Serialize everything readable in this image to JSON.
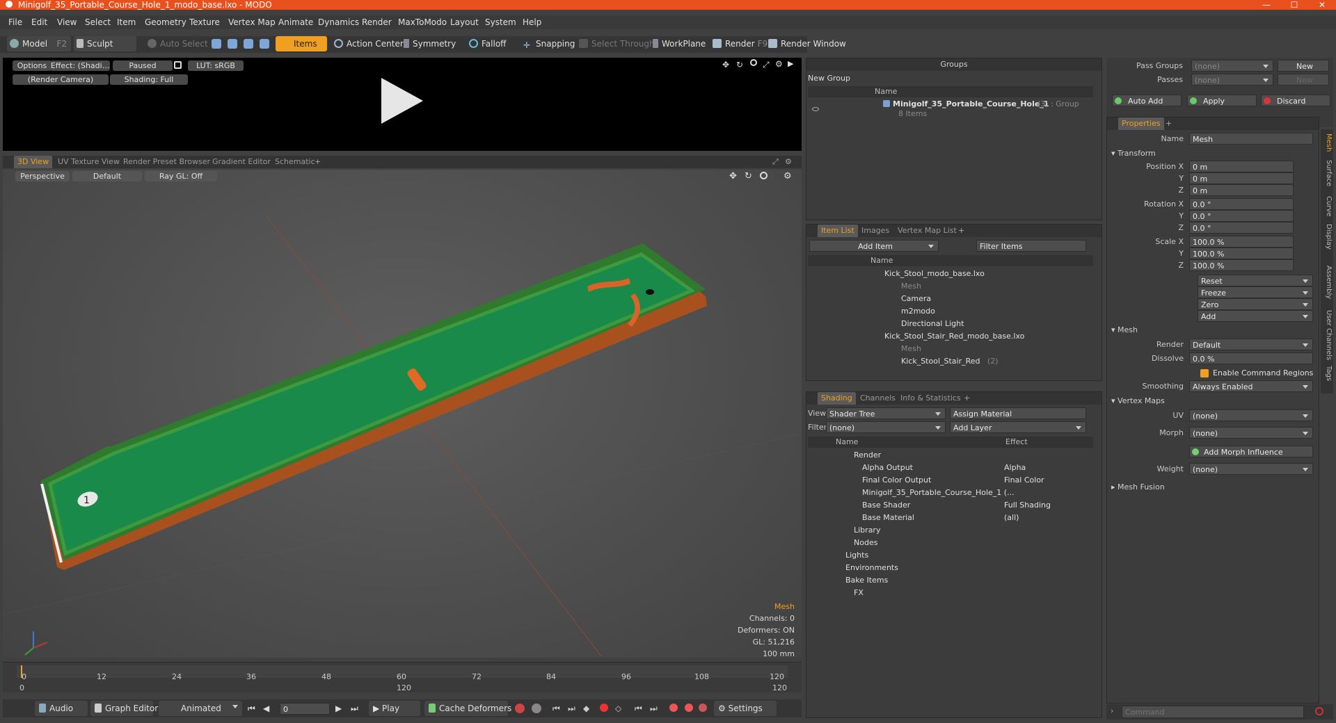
{
  "window": {
    "title": "Minigolf_35_Portable_Course_Hole_1_modo_base.lxo - MODO"
  },
  "menu": [
    "File",
    "Edit",
    "View",
    "Select",
    "Item",
    "Geometry",
    "Texture",
    "Vertex Map",
    "Animate",
    "Dynamics",
    "Render",
    "MaxToModo",
    "Layout",
    "System",
    "Help"
  ],
  "toolbar": {
    "model": "Model",
    "model_key": "F2",
    "sculpt": "Sculpt",
    "auto_select": "Auto Select",
    "items": "Items",
    "action_center": "Action Center",
    "symmetry": "Symmetry",
    "falloff": "Falloff",
    "snapping": "Snapping",
    "select_through": "Select Through",
    "workplane": "WorkPlane",
    "render": "Render",
    "render_key": "F9",
    "render_window": "Render Window"
  },
  "preview": {
    "options": "Options",
    "effect": "Effect: (Shadi...",
    "paused": "Paused",
    "lut": "LUT: sRGB",
    "camera": "(Render Camera)",
    "shading": "Shading: Full"
  },
  "viewport_tabs": [
    "3D View",
    "UV Texture View",
    "Render Preset Browser",
    "Gradient Editor",
    "Schematic"
  ],
  "viewport": {
    "perspective": "Perspective",
    "default": "Default",
    "raygl": "Ray GL: Off",
    "stats": [
      "Mesh",
      "Channels: 0",
      "Deformers: ON",
      "GL: 51,216",
      "100 mm"
    ]
  },
  "timeline": {
    "ticks": [
      "0",
      "12",
      "24",
      "36",
      "48",
      "60",
      "72",
      "84",
      "96",
      "108",
      "120"
    ],
    "sub_left": "0",
    "sub_mid": "120",
    "sub_right": "120"
  },
  "bottombar": {
    "audio": "Audio",
    "graph_editor": "Graph Editor",
    "animated": "Animated",
    "frame": "0",
    "play": "Play",
    "cache": "Cache Deformers",
    "settings": "Settings"
  },
  "groups": {
    "title": "Groups",
    "new_group": "New Group",
    "col_name": "Name",
    "item_name": "Minigolf_35_Portable_Course_Hole_1",
    "item_suffix": "(3) : Group",
    "item_sub": "8 Items"
  },
  "itemlist": {
    "tabs": [
      "Item List",
      "Images",
      "Vertex Map List"
    ],
    "add_item": "Add Item",
    "filter": "Filter Items",
    "col_name": "Name",
    "rows": [
      {
        "label": "Kick_Stool_modo_base.lxo",
        "dim": false
      },
      {
        "label": "Mesh",
        "dim": true
      },
      {
        "label": "Camera",
        "dim": false
      },
      {
        "label": "m2modo",
        "dim": false
      },
      {
        "label": "Directional Light",
        "dim": false
      },
      {
        "label": "Kick_Stool_Stair_Red_modo_base.lxo",
        "dim": false
      },
      {
        "label": "Mesh",
        "dim": true
      },
      {
        "label": "Kick_Stool_Stair_Red",
        "dim": false
      },
      {
        "label": "(2)",
        "dim": true
      }
    ]
  },
  "shading": {
    "tabs": [
      "Shading",
      "Channels",
      "Info & Statistics"
    ],
    "view_label": "View",
    "view_value": "Shader Tree",
    "assign": "Assign Material",
    "filter_label": "Filter",
    "filter_value": "(none)",
    "add_layer": "Add Layer",
    "col_name": "Name",
    "col_effect": "Effect",
    "rows": [
      {
        "name": "Render",
        "effect": ""
      },
      {
        "name": "Alpha Output",
        "effect": "Alpha"
      },
      {
        "name": "Final Color Output",
        "effect": "Final Color"
      },
      {
        "name": "Minigolf_35_Portable_Course_Hole_1 (...",
        "effect": ""
      },
      {
        "name": "Base Shader",
        "effect": "Full Shading"
      },
      {
        "name": "Base Material",
        "effect": "(all)"
      },
      {
        "name": "Library",
        "effect": ""
      },
      {
        "name": "Nodes",
        "effect": ""
      },
      {
        "name": "Lights",
        "effect": ""
      },
      {
        "name": "Environments",
        "effect": ""
      },
      {
        "name": "Bake Items",
        "effect": ""
      },
      {
        "name": "FX",
        "effect": ""
      }
    ]
  },
  "passes": {
    "pass_groups": "Pass Groups",
    "passes": "Passes",
    "none": "(none)",
    "new": "New",
    "auto_add": "Auto Add",
    "apply": "Apply",
    "discard": "Discard"
  },
  "properties": {
    "tab": "Properties",
    "name_label": "Name",
    "name_value": "Mesh",
    "transform": "Transform",
    "position_x": "Position X",
    "rotation_x": "Rotation X",
    "scale_x": "Scale X",
    "y": "Y",
    "z": "Z",
    "pos": [
      "0 m",
      "0 m",
      "0 m"
    ],
    "rot": [
      "0.0 °",
      "0.0 °",
      "0.0 °"
    ],
    "scale": [
      "100.0 %",
      "100.0 %",
      "100.0 %"
    ],
    "actions": [
      "Reset",
      "Freeze",
      "Zero",
      "Add"
    ],
    "mesh": "Mesh",
    "render_label": "Render",
    "render_value": "Default",
    "dissolve_label": "Dissolve",
    "dissolve_value": "0.0 %",
    "enable_cmd": "Enable Command Regions",
    "smoothing_label": "Smoothing",
    "smoothing_value": "Always Enabled",
    "vertex_maps": "Vertex Maps",
    "uv_label": "UV",
    "uv_value": "(none)",
    "morph_label": "Morph",
    "morph_value": "(none)",
    "add_morph": "Add Morph Influence",
    "weight_label": "Weight",
    "weight_value": "(none)",
    "mesh_fusion": "Mesh Fusion",
    "side_tabs": [
      "Mesh",
      "Surface",
      "Curve",
      "Display",
      "Assembly",
      "User Channels",
      "Tags"
    ]
  },
  "command": {
    "placeholder": "Command"
  }
}
